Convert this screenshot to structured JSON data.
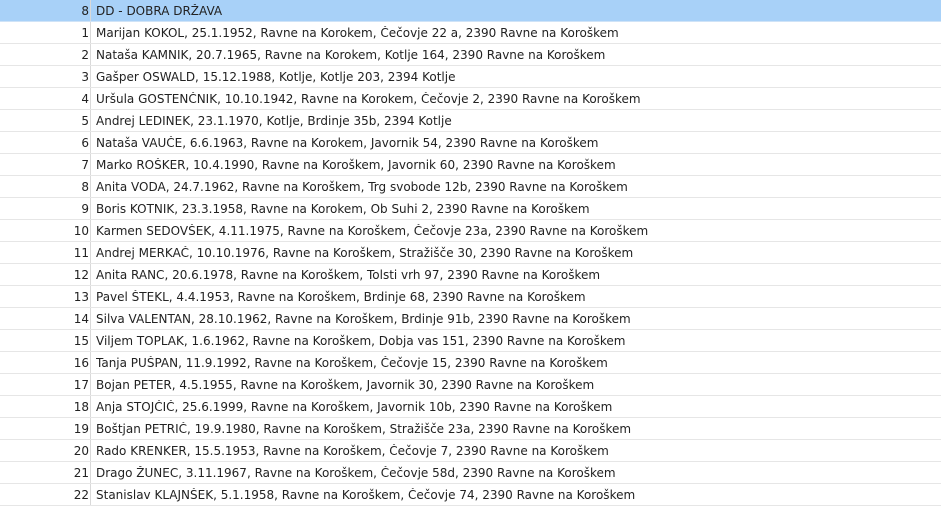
{
  "list": {
    "header": {
      "number": "8",
      "title": "DD - DOBRA DRŽAVA"
    },
    "rows": [
      {
        "number": "1",
        "text": "Marijan KOKOL, 25.1.1952, Ravne na Korokem, Čečovje 22 a, 2390 Ravne na Koroškem"
      },
      {
        "number": "2",
        "text": "Nataša KAMNIK, 20.7.1965, Ravne na Korokem, Kotlje 164, 2390 Ravne na Koroškem"
      },
      {
        "number": "3",
        "text": "Gašper OSWALD, 15.12.1988, Kotlje, Kotlje 203, 2394 Kotlje"
      },
      {
        "number": "4",
        "text": "Uršula GOSTENČNIK, 10.10.1942, Ravne na Korokem, Čečovje 2, 2390 Ravne na Koroškem"
      },
      {
        "number": "5",
        "text": "Andrej LEDINEK, 23.1.1970, Kotlje, Brdinje 35b, 2394 Kotlje"
      },
      {
        "number": "6",
        "text": "Nataša VAUČE, 6.6.1963, Ravne na Korokem, Javornik 54, 2390 Ravne na Koroškem"
      },
      {
        "number": "7",
        "text": "Marko ROŠKER, 10.4.1990, Ravne na Koroškem, Javornik 60, 2390 Ravne na Koroškem"
      },
      {
        "number": "8",
        "text": "Anita VODA, 24.7.1962, Ravne na Koroškem, Trg svobode 12b, 2390 Ravne na Koroškem"
      },
      {
        "number": "9",
        "text": "Boris KOTNIK, 23.3.1958, Ravne na Korokem, Ob Suhi 2, 2390 Ravne na Koroškem"
      },
      {
        "number": "10",
        "text": "Karmen SEDOVŠEK, 4.11.1975, Ravne na Koroškem, Čečovje 23a, 2390 Ravne na Koroškem"
      },
      {
        "number": "11",
        "text": "Andrej MERKAČ, 10.10.1976, Ravne na Koroškem, Stražišče 30, 2390 Ravne na Koroškem"
      },
      {
        "number": "12",
        "text": "Anita RANC, 20.6.1978, Ravne na Koroškem, Tolsti vrh 97, 2390 Ravne na Koroškem"
      },
      {
        "number": "13",
        "text": "Pavel ŠTEKL, 4.4.1953, Ravne na Koroškem, Brdinje 68, 2390 Ravne na Koroškem"
      },
      {
        "number": "14",
        "text": "Silva VALENTAN, 28.10.1962, Ravne na Koroškem, Brdinje 91b, 2390 Ravne na Koroškem"
      },
      {
        "number": "15",
        "text": "Viljem TOPLAK, 1.6.1962, Ravne na Koroškem, Dobja vas 151, 2390 Ravne na Koroškem"
      },
      {
        "number": "16",
        "text": "Tanja PUŠPAN, 11.9.1992, Ravne na Koroškem, Čečovje 15, 2390 Ravne na Koroškem"
      },
      {
        "number": "17",
        "text": "Bojan PETER, 4.5.1955, Ravne na Koroškem, Javornik 30, 2390 Ravne na Koroškem"
      },
      {
        "number": "18",
        "text": "Anja STOJČIČ, 25.6.1999, Ravne na Koroškem, Javornik 10b, 2390 Ravne na Koroškem"
      },
      {
        "number": "19",
        "text": "Boštjan PETRIČ, 19.9.1980, Ravne na Koroškem, Stražišče 23a, 2390 Ravne na Koroškem"
      },
      {
        "number": "20",
        "text": "Rado KRENKER, 15.5.1953, Ravne na Koroškem, Čečovje 7, 2390 Ravne na Koroškem"
      },
      {
        "number": "21",
        "text": "Drago ŽUNEC, 3.11.1967, Ravne na Koroškem, Čečovje 58d, 2390 Ravne na Koroškem"
      },
      {
        "number": "22",
        "text": "Stanislav KLAJNŠEK, 5.1.1958, Ravne na Koroškem, Čečovje 74, 2390 Ravne na Koroškem"
      }
    ]
  }
}
